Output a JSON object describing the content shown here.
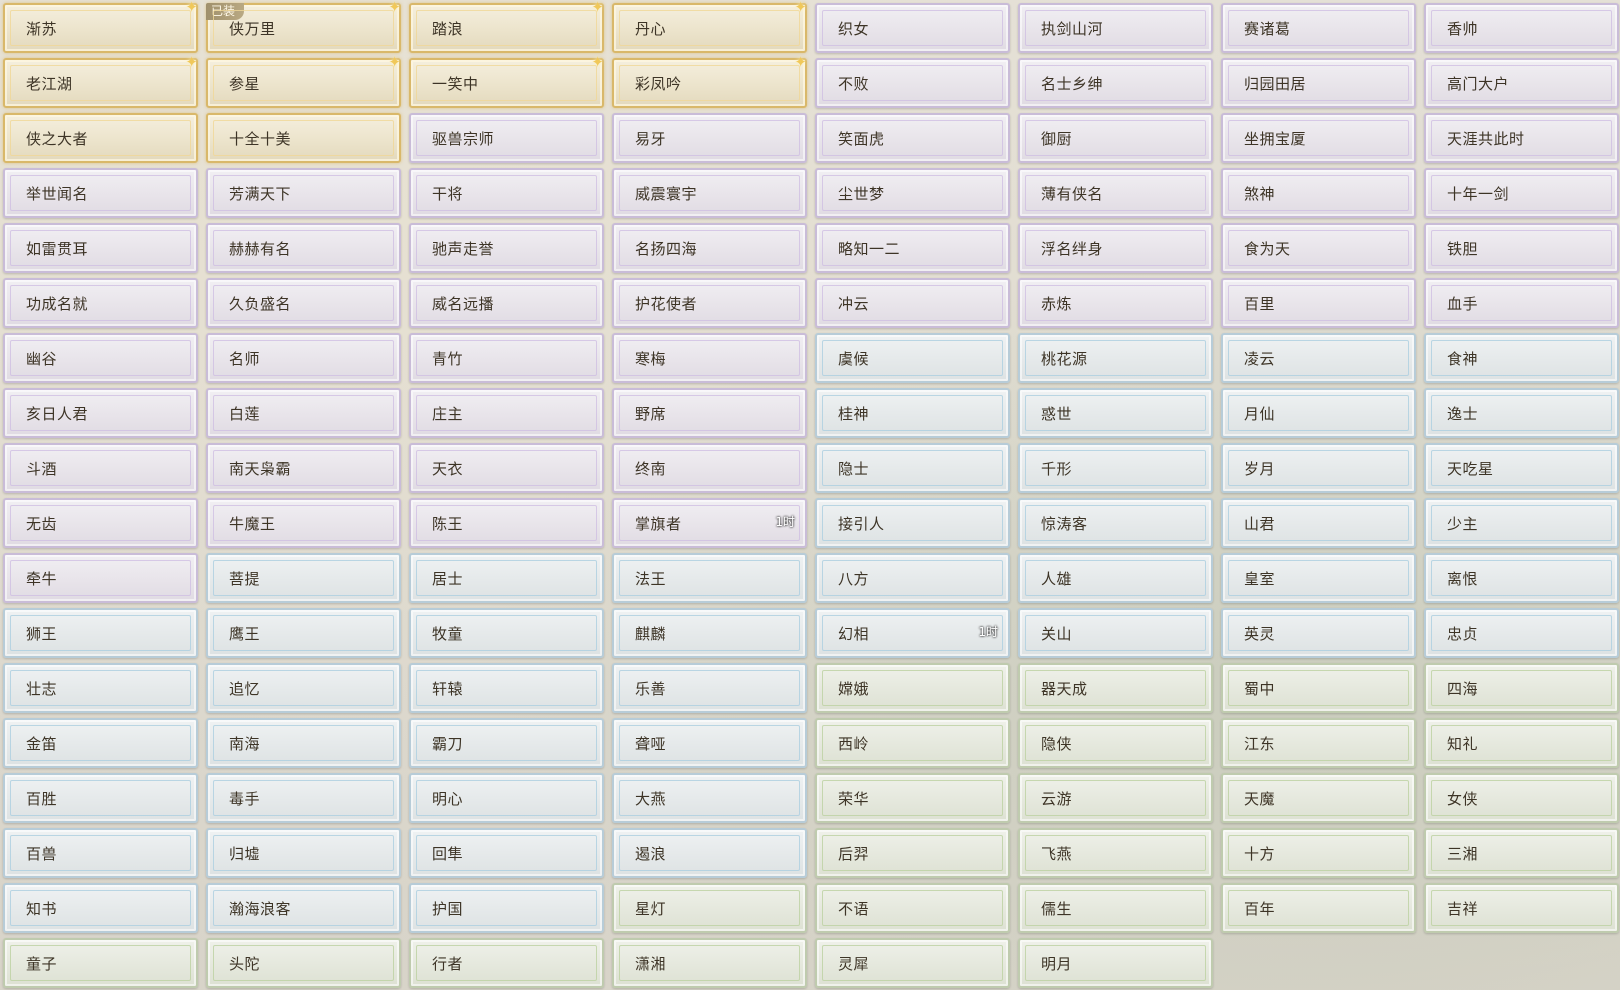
{
  "titles": [
    {
      "label": "渐苏",
      "rarity": "gold",
      "sparkle": true
    },
    {
      "label": "侠万里",
      "rarity": "gold",
      "sparkle": true,
      "tag": "已装"
    },
    {
      "label": "踏浪",
      "rarity": "gold",
      "sparkle": true
    },
    {
      "label": "丹心",
      "rarity": "gold",
      "sparkle": true
    },
    {
      "label": "织女",
      "rarity": "purple"
    },
    {
      "label": "执剑山河",
      "rarity": "purple"
    },
    {
      "label": "赛诸葛",
      "rarity": "purple"
    },
    {
      "label": "香帅",
      "rarity": "purple"
    },
    {
      "label": "老江湖",
      "rarity": "gold",
      "sparkle": true
    },
    {
      "label": "参星",
      "rarity": "gold",
      "sparkle": true
    },
    {
      "label": "一笑中",
      "rarity": "gold",
      "sparkle": true
    },
    {
      "label": "彩凤吟",
      "rarity": "gold",
      "sparkle": true
    },
    {
      "label": "不败",
      "rarity": "purple"
    },
    {
      "label": "名士乡绅",
      "rarity": "purple"
    },
    {
      "label": "归园田居",
      "rarity": "purple"
    },
    {
      "label": "高门大户",
      "rarity": "purple"
    },
    {
      "label": "侠之大者",
      "rarity": "gold"
    },
    {
      "label": "十全十美",
      "rarity": "gold"
    },
    {
      "label": "驱兽宗师",
      "rarity": "purple"
    },
    {
      "label": "易牙",
      "rarity": "purple"
    },
    {
      "label": "笑面虎",
      "rarity": "purple"
    },
    {
      "label": "御厨",
      "rarity": "purple"
    },
    {
      "label": "坐拥宝厦",
      "rarity": "purple"
    },
    {
      "label": "天涯共此时",
      "rarity": "purple"
    },
    {
      "label": "举世闻名",
      "rarity": "purple"
    },
    {
      "label": "芳满天下",
      "rarity": "purple"
    },
    {
      "label": "干将",
      "rarity": "purple"
    },
    {
      "label": "威震寰宇",
      "rarity": "purple"
    },
    {
      "label": "尘世梦",
      "rarity": "purple"
    },
    {
      "label": "薄有侠名",
      "rarity": "purple"
    },
    {
      "label": "煞神",
      "rarity": "purple"
    },
    {
      "label": "十年一剑",
      "rarity": "purple"
    },
    {
      "label": "如雷贯耳",
      "rarity": "purple"
    },
    {
      "label": "赫赫有名",
      "rarity": "purple"
    },
    {
      "label": "驰声走誉",
      "rarity": "purple"
    },
    {
      "label": "名扬四海",
      "rarity": "purple"
    },
    {
      "label": "略知一二",
      "rarity": "purple"
    },
    {
      "label": "浮名绊身",
      "rarity": "purple"
    },
    {
      "label": "食为天",
      "rarity": "purple"
    },
    {
      "label": "铁胆",
      "rarity": "purple"
    },
    {
      "label": "功成名就",
      "rarity": "purple"
    },
    {
      "label": "久负盛名",
      "rarity": "purple"
    },
    {
      "label": "威名远播",
      "rarity": "purple"
    },
    {
      "label": "护花使者",
      "rarity": "purple"
    },
    {
      "label": "冲云",
      "rarity": "purple"
    },
    {
      "label": "赤炼",
      "rarity": "purple"
    },
    {
      "label": "百里",
      "rarity": "purple"
    },
    {
      "label": "血手",
      "rarity": "purple"
    },
    {
      "label": "幽谷",
      "rarity": "purple"
    },
    {
      "label": "名师",
      "rarity": "purple"
    },
    {
      "label": "青竹",
      "rarity": "purple"
    },
    {
      "label": "寒梅",
      "rarity": "purple"
    },
    {
      "label": "虞候",
      "rarity": "blue"
    },
    {
      "label": "桃花源",
      "rarity": "blue"
    },
    {
      "label": "凌云",
      "rarity": "blue"
    },
    {
      "label": "食神",
      "rarity": "blue"
    },
    {
      "label": "亥日人君",
      "rarity": "purple"
    },
    {
      "label": "白莲",
      "rarity": "purple"
    },
    {
      "label": "庄主",
      "rarity": "purple"
    },
    {
      "label": "野席",
      "rarity": "purple"
    },
    {
      "label": "桂神",
      "rarity": "blue"
    },
    {
      "label": "惑世",
      "rarity": "blue"
    },
    {
      "label": "月仙",
      "rarity": "blue"
    },
    {
      "label": "逸士",
      "rarity": "blue"
    },
    {
      "label": "斗酒",
      "rarity": "purple"
    },
    {
      "label": "南天枭霸",
      "rarity": "purple"
    },
    {
      "label": "天衣",
      "rarity": "purple"
    },
    {
      "label": "终南",
      "rarity": "purple"
    },
    {
      "label": "隐士",
      "rarity": "blue"
    },
    {
      "label": "千形",
      "rarity": "blue"
    },
    {
      "label": "岁月",
      "rarity": "blue"
    },
    {
      "label": "天吃星",
      "rarity": "blue"
    },
    {
      "label": "无齿",
      "rarity": "purple"
    },
    {
      "label": "牛魔王",
      "rarity": "purple"
    },
    {
      "label": "陈王",
      "rarity": "purple"
    },
    {
      "label": "掌旗者",
      "rarity": "purple",
      "timer": "1时"
    },
    {
      "label": "接引人",
      "rarity": "blue"
    },
    {
      "label": "惊涛客",
      "rarity": "blue"
    },
    {
      "label": "山君",
      "rarity": "blue"
    },
    {
      "label": "少主",
      "rarity": "blue"
    },
    {
      "label": "牵牛",
      "rarity": "purple"
    },
    {
      "label": "菩提",
      "rarity": "blue"
    },
    {
      "label": "居士",
      "rarity": "blue"
    },
    {
      "label": "法王",
      "rarity": "blue"
    },
    {
      "label": "八方",
      "rarity": "blue"
    },
    {
      "label": "人雄",
      "rarity": "blue"
    },
    {
      "label": "皇室",
      "rarity": "blue"
    },
    {
      "label": "离恨",
      "rarity": "blue"
    },
    {
      "label": "狮王",
      "rarity": "blue"
    },
    {
      "label": "鹰王",
      "rarity": "blue"
    },
    {
      "label": "牧童",
      "rarity": "blue"
    },
    {
      "label": "麒麟",
      "rarity": "blue"
    },
    {
      "label": "幻相",
      "rarity": "blue",
      "timer": "1时"
    },
    {
      "label": "关山",
      "rarity": "blue"
    },
    {
      "label": "英灵",
      "rarity": "blue"
    },
    {
      "label": "忠贞",
      "rarity": "blue"
    },
    {
      "label": "壮志",
      "rarity": "blue"
    },
    {
      "label": "追忆",
      "rarity": "blue"
    },
    {
      "label": "轩辕",
      "rarity": "blue"
    },
    {
      "label": "乐善",
      "rarity": "blue"
    },
    {
      "label": "嫦娥",
      "rarity": "green"
    },
    {
      "label": "器天成",
      "rarity": "green"
    },
    {
      "label": "蜀中",
      "rarity": "green"
    },
    {
      "label": "四海",
      "rarity": "green"
    },
    {
      "label": "金笛",
      "rarity": "blue"
    },
    {
      "label": "南海",
      "rarity": "blue"
    },
    {
      "label": "霸刀",
      "rarity": "blue"
    },
    {
      "label": "聋哑",
      "rarity": "blue"
    },
    {
      "label": "西岭",
      "rarity": "green"
    },
    {
      "label": "隐侠",
      "rarity": "green"
    },
    {
      "label": "江东",
      "rarity": "green"
    },
    {
      "label": "知礼",
      "rarity": "green"
    },
    {
      "label": "百胜",
      "rarity": "blue"
    },
    {
      "label": "毒手",
      "rarity": "blue"
    },
    {
      "label": "明心",
      "rarity": "blue"
    },
    {
      "label": "大燕",
      "rarity": "blue"
    },
    {
      "label": "荣华",
      "rarity": "green"
    },
    {
      "label": "云游",
      "rarity": "green"
    },
    {
      "label": "天魔",
      "rarity": "green"
    },
    {
      "label": "女侠",
      "rarity": "green"
    },
    {
      "label": "百兽",
      "rarity": "blue"
    },
    {
      "label": "归墟",
      "rarity": "blue"
    },
    {
      "label": "回隼",
      "rarity": "blue"
    },
    {
      "label": "遏浪",
      "rarity": "blue"
    },
    {
      "label": "后羿",
      "rarity": "green"
    },
    {
      "label": "飞燕",
      "rarity": "green"
    },
    {
      "label": "十方",
      "rarity": "green"
    },
    {
      "label": "三湘",
      "rarity": "green"
    },
    {
      "label": "知书",
      "rarity": "blue"
    },
    {
      "label": "瀚海浪客",
      "rarity": "blue"
    },
    {
      "label": "护国",
      "rarity": "blue"
    },
    {
      "label": "星灯",
      "rarity": "green"
    },
    {
      "label": "不语",
      "rarity": "green"
    },
    {
      "label": "儒生",
      "rarity": "green"
    },
    {
      "label": "百年",
      "rarity": "green"
    },
    {
      "label": "吉祥",
      "rarity": "green"
    },
    {
      "label": "童子",
      "rarity": "green"
    },
    {
      "label": "头陀",
      "rarity": "green"
    },
    {
      "label": "行者",
      "rarity": "green"
    },
    {
      "label": "潇湘",
      "rarity": "green"
    },
    {
      "label": "灵犀",
      "rarity": "green"
    },
    {
      "label": "明月",
      "rarity": "green"
    }
  ]
}
